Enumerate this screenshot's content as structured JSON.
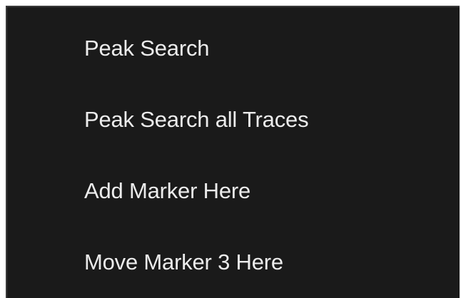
{
  "context_menu": {
    "items": [
      {
        "label": "Peak Search"
      },
      {
        "label": "Peak Search all Traces"
      },
      {
        "label": "Add Marker Here"
      },
      {
        "label": "Move Marker 3 Here"
      }
    ]
  },
  "colors": {
    "menu_background": "#1a1a1a",
    "menu_text": "#ececec",
    "menu_border": "#3a3a3a"
  }
}
